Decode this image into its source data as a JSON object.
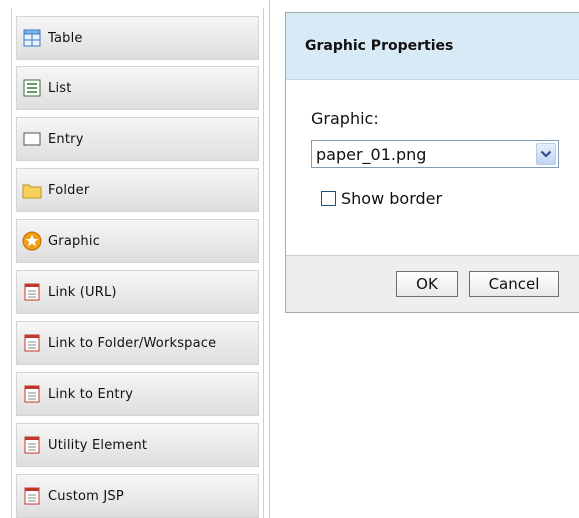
{
  "palette": {
    "items": [
      {
        "label": "Table",
        "icon": "table-icon"
      },
      {
        "label": "List",
        "icon": "list-icon"
      },
      {
        "label": "Entry",
        "icon": "entry-icon"
      },
      {
        "label": "Folder",
        "icon": "folder-icon"
      },
      {
        "label": "Graphic",
        "icon": "graphic-star-icon"
      },
      {
        "label": "Link (URL)",
        "icon": "link-url-icon"
      },
      {
        "label": "Link to Folder/Workspace",
        "icon": "link-folder-icon"
      },
      {
        "label": "Link to Entry",
        "icon": "link-entry-icon"
      },
      {
        "label": "Utility Element",
        "icon": "utility-element-icon"
      },
      {
        "label": "Custom JSP",
        "icon": "custom-jsp-icon"
      }
    ]
  },
  "dialog": {
    "title": "Graphic Properties",
    "graphic_label": "Graphic:",
    "graphic_value": "paper_01.png",
    "show_border_label": "Show border",
    "show_border_checked": false,
    "ok_label": "OK",
    "cancel_label": "Cancel"
  },
  "colors": {
    "title_bar": "#d9eaf7",
    "footer": "#eeeeee",
    "icon_red": "#c0392b",
    "icon_orange": "#f39c12",
    "folder_yellow": "#f6d25a"
  }
}
